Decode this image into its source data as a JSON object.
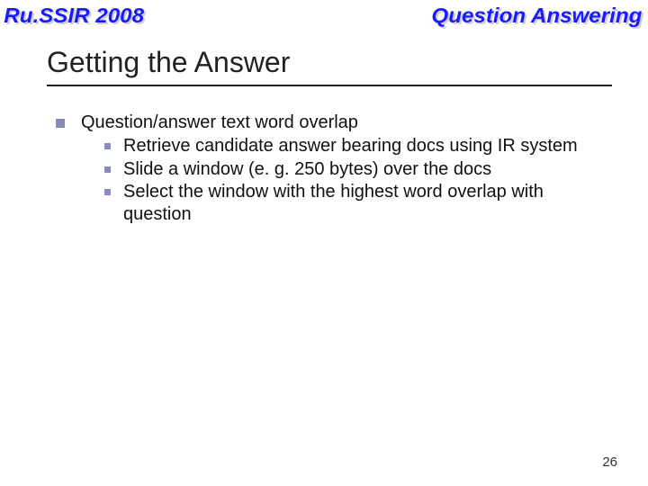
{
  "header": {
    "left": "Ru.SSIR 2008",
    "right": "Question Answering"
  },
  "title": "Getting the Answer",
  "bullets": {
    "main": "Question/answer text word overlap",
    "subs": [
      "Retrieve candidate answer bearing docs using IR system",
      "Slide a window (e. g. 250 bytes) over the docs",
      "Select the window with the highest word overlap with question"
    ]
  },
  "page_number": "26"
}
